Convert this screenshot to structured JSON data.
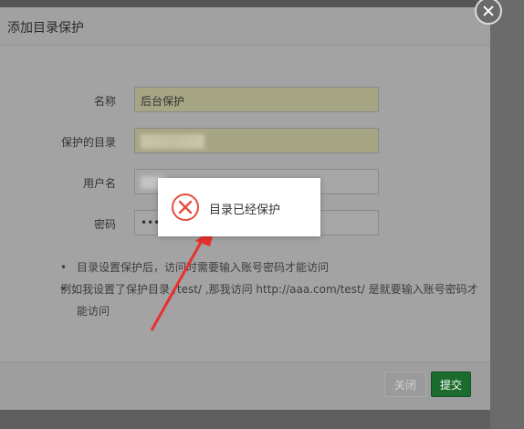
{
  "dialog": {
    "title": "添加目录保护",
    "fields": [
      {
        "label": "名称",
        "value": "后台保护"
      },
      {
        "label": "保护的目录",
        "value": ""
      },
      {
        "label": "用户名",
        "value": ""
      },
      {
        "label": "密码",
        "value": "•••"
      }
    ],
    "notes": [
      "目录设置保护后，访问时需要输入账号密码才能访问",
      "例如我设置了保护目录 /test/ ,那我访问 http://aaa.com/test/ 是就要输入账号密码才能访问"
    ],
    "buttons": {
      "close": "关闭",
      "submit": "提交"
    }
  },
  "toast": {
    "message": "目录已经保护",
    "icon": "error-circle-icon"
  },
  "colors": {
    "submit": "#1b6b2e",
    "toast_icon": "#e74c3c",
    "arrow": "#e8312f"
  }
}
